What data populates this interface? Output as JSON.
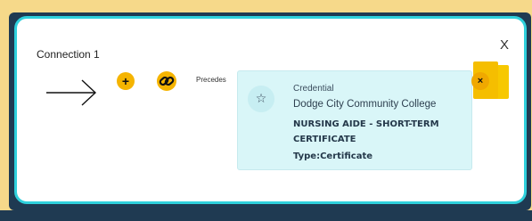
{
  "modal": {
    "title": "Connection 1",
    "close_label": "X",
    "add_label": "+",
    "relationship_label": "Precedes",
    "remove_label": "×"
  },
  "card": {
    "icon": "star-icon",
    "type": "Credential",
    "organization": "Dodge City Community College",
    "name": "NURSING AIDE - SHORT-TERM CERTIFICATE",
    "type_line": "Type:Certificate"
  },
  "colors": {
    "accent": "#f5b400",
    "modal_border": "#2fd0dc",
    "card_bg": "#d9f6f8",
    "backdrop": "#1f3a52",
    "page_bg": "#f6d98a"
  }
}
